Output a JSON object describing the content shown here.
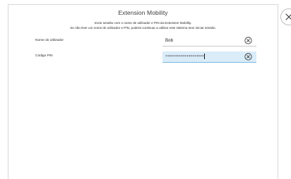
{
  "dialog": {
    "title": "Extension Mobility",
    "instruction_line1": "Inicie sessão com o nome de utilizador e PIN da Extension Mobility.",
    "instruction_line2": "Se não tiver um nome de utilizador e PIN, poderá continuar a utilizar este sistema sem iniciar sessão."
  },
  "form": {
    "username_label": "Nome do utilizador",
    "username_value": "Bob",
    "pin_label": "Código PIN",
    "pin_value": "********************"
  },
  "icons": {
    "clear_username": "clear-circle-x-icon",
    "clear_pin": "clear-circle-x-icon",
    "close_dialog": "close-x-icon"
  },
  "colors": {
    "focused_field_background": "#d9ecf8",
    "focused_field_underline": "#7bb6e0",
    "title_text": "#3a3a3a"
  }
}
